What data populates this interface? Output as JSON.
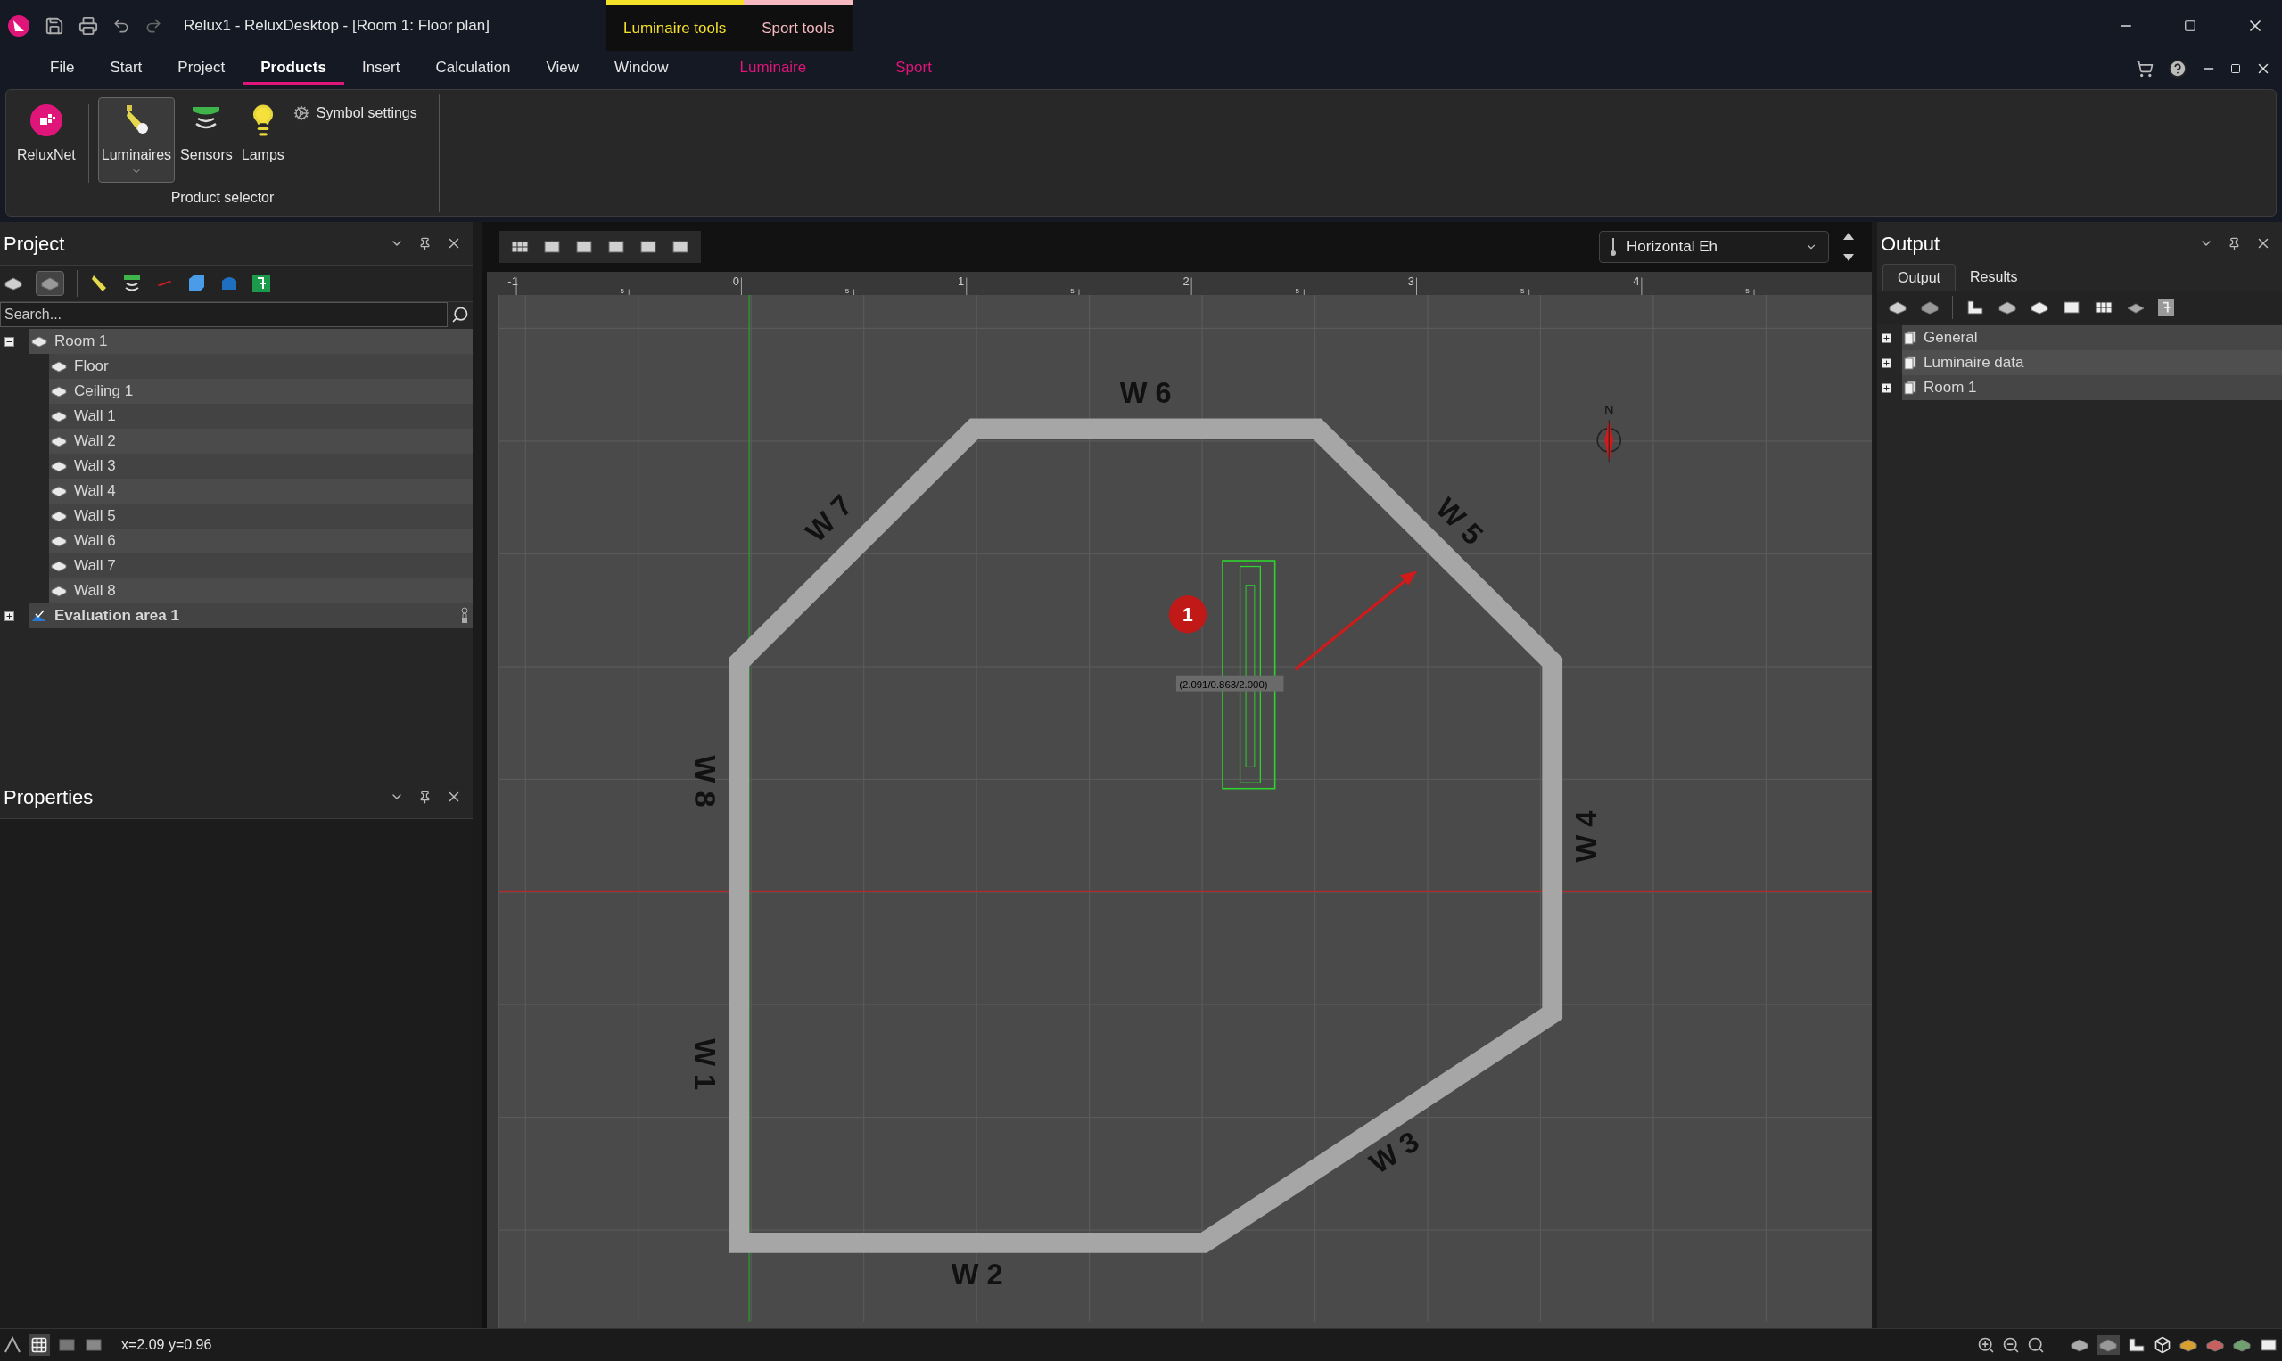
{
  "window": {
    "title": "Relux1 - ReluxDesktop - [Room 1: Floor plan]"
  },
  "context_tabs": [
    {
      "label": "Luminaire tools",
      "color": "#f5e02a"
    },
    {
      "label": "Sport tools",
      "color": "#f6b9c2"
    }
  ],
  "menu_tabs": [
    {
      "label": "File",
      "selected": false,
      "kind": "plain"
    },
    {
      "label": "Start",
      "selected": false,
      "kind": "plain"
    },
    {
      "label": "Project",
      "selected": false,
      "kind": "plain"
    },
    {
      "label": "Products",
      "selected": true,
      "kind": "plain"
    },
    {
      "label": "Insert",
      "selected": false,
      "kind": "plain"
    },
    {
      "label": "Calculation",
      "selected": false,
      "kind": "plain"
    },
    {
      "label": "View",
      "selected": false,
      "kind": "plain"
    },
    {
      "label": "Window",
      "selected": false,
      "kind": "plain"
    },
    {
      "label": "Luminaire",
      "selected": false,
      "kind": "context"
    },
    {
      "label": "Sport",
      "selected": false,
      "kind": "context"
    }
  ],
  "ribbon": {
    "buttons": [
      {
        "label": "ReluxNet",
        "selected": false,
        "kind": "net"
      },
      {
        "label": "Luminaires",
        "selected": true,
        "kind": "luminaire"
      },
      {
        "label": "Sensors",
        "selected": false,
        "kind": "sensor"
      },
      {
        "label": "Lamps",
        "selected": false,
        "kind": "lamp"
      }
    ],
    "symbol_settings": "Symbol settings",
    "group_label": "Product selector"
  },
  "project_panel": {
    "title": "Project",
    "search": {
      "placeholder": "Search..."
    },
    "tree": [
      {
        "label": "Room 1",
        "kind": "room",
        "expanded": true,
        "children": [
          {
            "label": "Floor"
          },
          {
            "label": "Ceiling 1"
          },
          {
            "label": "Wall 1"
          },
          {
            "label": "Wall 2"
          },
          {
            "label": "Wall 3"
          },
          {
            "label": "Wall 4"
          },
          {
            "label": "Wall 5"
          },
          {
            "label": "Wall 6"
          },
          {
            "label": "Wall 7"
          },
          {
            "label": "Wall 8"
          }
        ]
      },
      {
        "label": "Evaluation area 1",
        "kind": "area",
        "expanded": false
      }
    ]
  },
  "properties_panel": {
    "title": "Properties"
  },
  "canvas": {
    "view_select": "Horizontal Eh",
    "ruler_labels": [
      "-1",
      "5",
      "0",
      "5",
      "1",
      "5",
      "2",
      "5",
      "3",
      "5",
      "4",
      "5"
    ],
    "walls": [
      {
        "label": "W 1"
      },
      {
        "label": "W 2"
      },
      {
        "label": "W 3"
      },
      {
        "label": "W 4"
      },
      {
        "label": "W 5"
      },
      {
        "label": "W 6"
      },
      {
        "label": "W 7"
      },
      {
        "label": "W 8"
      }
    ],
    "luminaire": {
      "number": "1",
      "coordinates": "(2.091/0.863/2.000)"
    },
    "compass": "N"
  },
  "output_panel": {
    "title": "Output",
    "tabs": [
      {
        "label": "Output",
        "selected": true
      },
      {
        "label": "Results",
        "selected": false
      }
    ],
    "tree": [
      {
        "label": "General",
        "expanded": false
      },
      {
        "label": "Luminaire data",
        "expanded": false
      },
      {
        "label": "Room 1",
        "expanded": false
      }
    ]
  },
  "status_bar": {
    "coordinates": "x=2.09 y=0.96"
  }
}
